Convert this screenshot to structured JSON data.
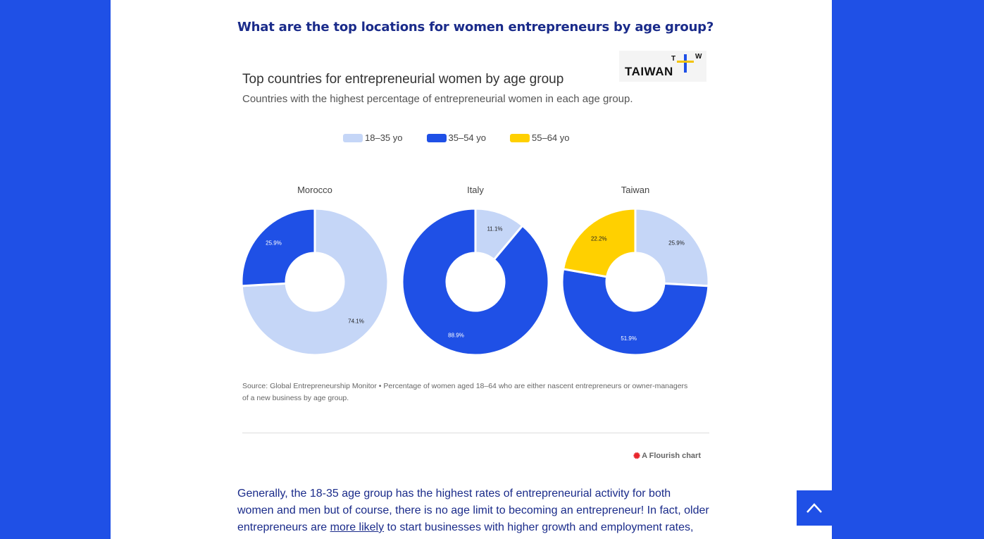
{
  "heading": "What are the top locations for women entrepreneurs by age group?",
  "logo": {
    "word": "TAIWAN",
    "t": "T",
    "w": "W"
  },
  "chart_data": {
    "type": "pie",
    "title": "Top countries for entrepreneurial women by age group",
    "subtitle": "Countries with the highest percentage of entrepreneurial women in each age group.",
    "legend": [
      {
        "name": "18–35 yo",
        "color": "#c5d6f7"
      },
      {
        "name": "35–54 yo",
        "color": "#1f50e6"
      },
      {
        "name": "55–64 yo",
        "color": "#ffd000"
      }
    ],
    "charts": [
      {
        "country": "Morocco",
        "slices": [
          {
            "series": 0,
            "value": 74.1,
            "label": "74.1%"
          },
          {
            "series": 1,
            "value": 25.9,
            "label": "25.9%"
          }
        ]
      },
      {
        "country": "Italy",
        "slices": [
          {
            "series": 0,
            "value": 11.1,
            "label": "11.1%"
          },
          {
            "series": 1,
            "value": 88.9,
            "label": "88.9%"
          }
        ]
      },
      {
        "country": "Taiwan",
        "slices": [
          {
            "series": 0,
            "value": 25.9,
            "label": "25.9%"
          },
          {
            "series": 1,
            "value": 51.9,
            "label": "51.9%"
          },
          {
            "series": 2,
            "value": 22.2,
            "label": "22.2%"
          }
        ]
      }
    ],
    "source": "Source: Global Entrepreneurship Monitor • Percentage of women aged 18–64 who are either nascent entrepreneurs or owner-managers of a new business by age group."
  },
  "flourish_label": "A Flourish chart",
  "paragraph": {
    "text1": "Generally, the 18-35 age group has the highest rates of entrepreneurial activity for both women and men but of course, there is no age limit to becoming an entrepreneur! In fact, older entrepreneurs are ",
    "link": "more likely",
    "text2": " to start businesses with higher growth and employment rates,"
  },
  "back_to_top": "chevron-up-icon"
}
